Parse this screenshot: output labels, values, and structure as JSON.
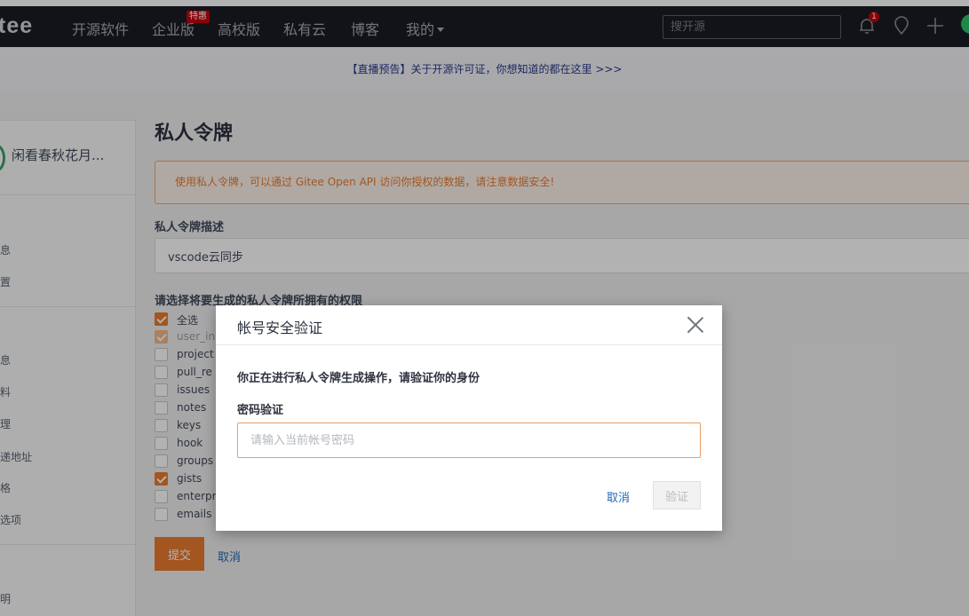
{
  "navbar": {
    "logo": "tee",
    "items": [
      "开源软件",
      "企业版",
      "高校版",
      "私有云",
      "博客",
      "我的"
    ],
    "hot_badge": "特惠",
    "search_placeholder": "搜开源",
    "notification_count": "1",
    "icons": [
      "bell-icon",
      "location-icon",
      "plus-icon",
      "avatar"
    ]
  },
  "announce": "【直播预告】关于开源许可证，你想知道的都在这里 >>>",
  "sidebar": {
    "user_name": "闲看春秋花月...",
    "items": [
      "息",
      "置",
      "息",
      "料",
      "理",
      "递地址",
      "格",
      "选项",
      "明"
    ]
  },
  "main": {
    "title": "私人令牌",
    "warning": "使用私人令牌，可以通过 Gitee Open API 访问你授权的数据，请注意数据安全!",
    "desc_label": "私人令牌描述",
    "desc_value": "vscode云同步",
    "perm_label": "请选择将要生成的私人令牌所拥有的权限",
    "permissions": [
      {
        "label": "全选",
        "state": "checked"
      },
      {
        "label": "user_in",
        "state": "disabled-checked"
      },
      {
        "label": "project",
        "state": "unchecked"
      },
      {
        "label": "pull_re",
        "state": "unchecked"
      },
      {
        "label": "issues",
        "state": "unchecked"
      },
      {
        "label": "notes",
        "state": "unchecked"
      },
      {
        "label": "keys",
        "state": "unchecked"
      },
      {
        "label": "hook",
        "state": "unchecked"
      },
      {
        "label": "groups",
        "state": "unchecked"
      },
      {
        "label": "gists",
        "state": "checked"
      },
      {
        "label": "enterpr",
        "state": "unchecked"
      },
      {
        "label": "emails",
        "state": "unchecked"
      }
    ],
    "submit": "提交",
    "cancel": "取消"
  },
  "modal": {
    "title": "帐号安全验证",
    "message": "你正在进行私人令牌生成操作，请验证你的身份",
    "password_label": "密码验证",
    "password_placeholder": "请输入当前帐号密码",
    "cancel": "取消",
    "verify": "验证"
  },
  "colors": {
    "accent": "#ea7b2e",
    "navbar_bg": "#1a1c23",
    "link": "#1f6bb8",
    "notification": "#c7000b"
  }
}
